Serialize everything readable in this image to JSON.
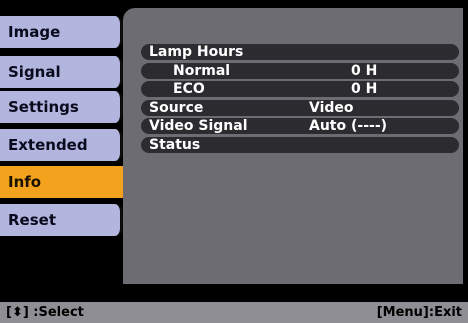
{
  "menu": [
    {
      "label": "Image",
      "active": false
    },
    {
      "label": "Signal",
      "active": false
    },
    {
      "label": "Settings",
      "active": false
    },
    {
      "label": "Extended",
      "active": false
    },
    {
      "label": "Info",
      "active": true
    },
    {
      "label": "Reset",
      "active": false
    }
  ],
  "info": {
    "lamp_hours_label": "Lamp Hours",
    "normal_label": "Normal",
    "normal_value": "0 H",
    "eco_label": "ECO",
    "eco_value": "0 H",
    "source_label": "Source",
    "source_value": "Video",
    "video_signal_label": "Video Signal",
    "video_signal_value": "Auto (----)",
    "status_label": "Status",
    "status_value": ""
  },
  "footer": {
    "select_hint": "[⬍] :Select",
    "exit_hint": "[Menu]:Exit"
  },
  "colors": {
    "menu_bg": "#b2b6de",
    "menu_active_bg": "#f2a21c",
    "panel_bg": "#6c6c72",
    "row_bg": "#2c2c30",
    "footer_bg": "#8e8e94"
  }
}
